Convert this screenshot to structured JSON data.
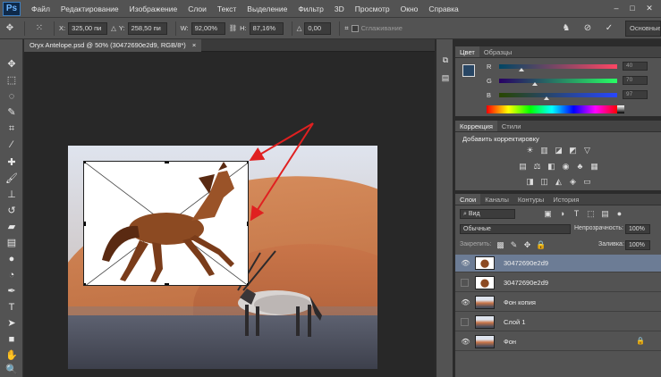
{
  "app": {
    "logo": "Ps"
  },
  "menu": [
    "Файл",
    "Редактирование",
    "Изображение",
    "Слои",
    "Текст",
    "Выделение",
    "Фильтр",
    "3D",
    "Просмотр",
    "Окно",
    "Справка"
  ],
  "window_controls": [
    "–",
    "□",
    "✕"
  ],
  "options": {
    "x_label": "X:",
    "x_value": "325,00 пи",
    "y_label": "Y:",
    "y_value": "258,50 пи",
    "w_label": "W:",
    "w_value": "92,00%",
    "h_label": "H:",
    "h_value": "87,16%",
    "angle_label": "△",
    "angle_value": "0,00",
    "interp_label": "Сглаживание",
    "workspace": "Основные"
  },
  "document": {
    "tab_label": "Oryx Antelope.psd @ 50% (30472690e2d9, RGB/8*)",
    "close": "×"
  },
  "color_panel": {
    "tabs": [
      "Цвет",
      "Образцы"
    ],
    "sliders": [
      {
        "label": "R",
        "value": "40",
        "knob": 0.19
      },
      {
        "label": "G",
        "value": "70",
        "knob": 0.3
      },
      {
        "label": "B",
        "value": "97",
        "knob": 0.4
      }
    ],
    "fg_color": "#284664"
  },
  "adjust_panel": {
    "tabs": [
      "Коррекция",
      "Стили"
    ],
    "heading": "Добавить корректировку"
  },
  "layers_panel": {
    "tabs": [
      "Слои",
      "Каналы",
      "Контуры",
      "История"
    ],
    "search_placeholder": "Вид",
    "blend_mode": "Обычные",
    "opacity_label": "Непрозрачность:",
    "opacity_value": "100%",
    "lock_label": "Закрепить:",
    "fill_label": "Заливка:",
    "fill_value": "100%",
    "layers": [
      {
        "name": "30472690e2d9",
        "visible": true,
        "selected": true,
        "locked": false,
        "thumb": "horse"
      },
      {
        "name": "30472690e2d9",
        "visible": false,
        "selected": false,
        "locked": false,
        "thumb": "horse"
      },
      {
        "name": "Фон копия",
        "visible": true,
        "selected": false,
        "locked": false,
        "thumb": "desert"
      },
      {
        "name": "Слой 1",
        "visible": false,
        "selected": false,
        "locked": false,
        "thumb": "desert"
      },
      {
        "name": "Фон",
        "visible": true,
        "selected": false,
        "locked": true,
        "thumb": "desert"
      }
    ]
  }
}
